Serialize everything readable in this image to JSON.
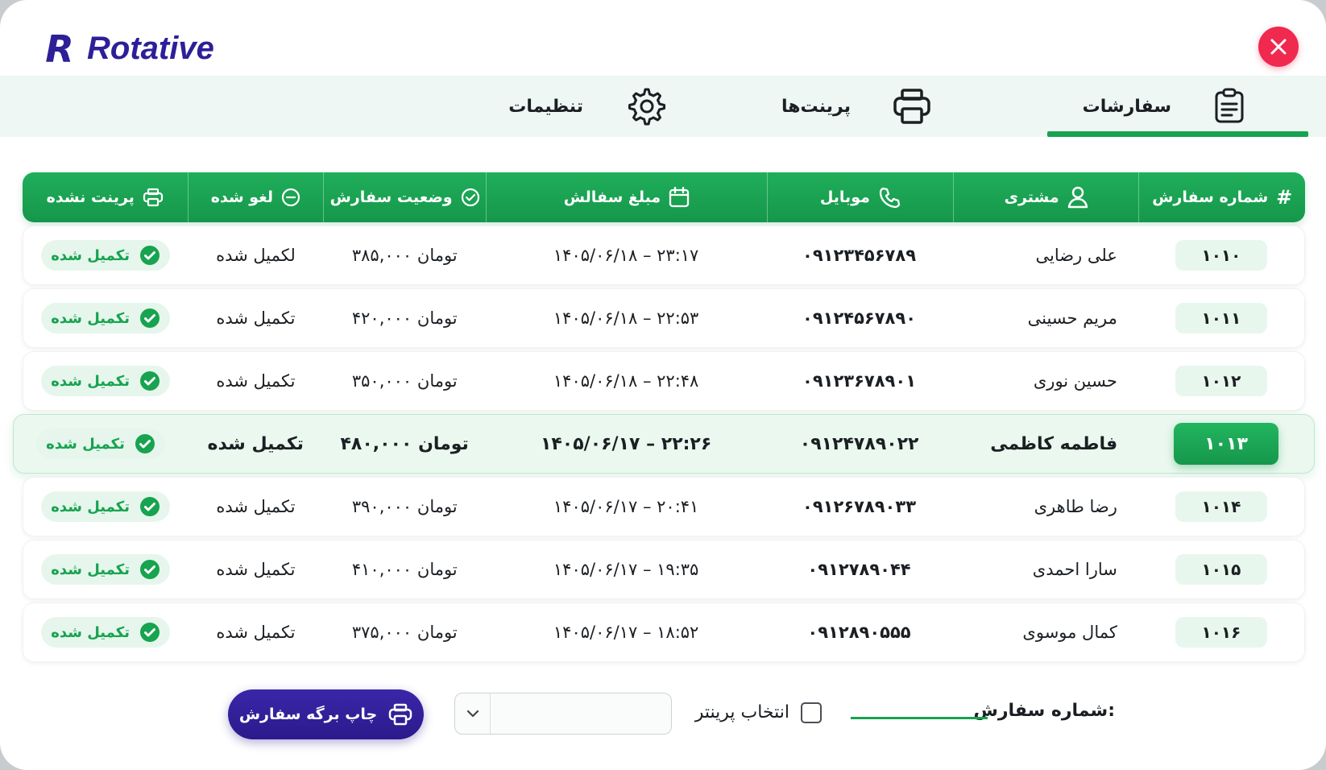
{
  "brand": {
    "mark": "R",
    "name": "Rotative"
  },
  "colors": {
    "accent": "#17a34f",
    "brand": "#2d1f98",
    "close": "#f0294f"
  },
  "tabs": [
    {
      "label": "سفارشات",
      "icon": "clipboard-icon",
      "active": true
    },
    {
      "label": "پرینت‌ها",
      "icon": "printer-icon",
      "active": false
    },
    {
      "label": "تنظیمات",
      "icon": "gear-icon",
      "active": false
    }
  ],
  "table": {
    "headers": {
      "id": "شماره سفارش",
      "customer": "مشتری",
      "mobile": "موبایل",
      "amount": "مبلغ سفالش",
      "status": "وضعیت سفارش",
      "cancelled": "لغو شده",
      "print": "پرینت نشده"
    },
    "rows": [
      {
        "id": "۱۰۱۰",
        "customer": "علی رضایی",
        "mobile": "۰۹۱۲۳۴۵۶۷۸۹",
        "date": "۱۴۰۵/۰۶/۱۸ – ۲۳:۱۷",
        "amount": "۳۸۵,۰۰۰ تومان",
        "status": "لکمیل شده",
        "badge": "تکمیل شده"
      },
      {
        "id": "۱۰۱۱",
        "customer": "مریم حسینی",
        "mobile": "۰۹۱۲۴۵۶۷۸۹۰",
        "date": "۱۴۰۵/۰۶/۱۸ – ۲۲:۵۳",
        "amount": "۴۲۰,۰۰۰ تومان",
        "status": "تکمیل شده",
        "badge": "تکمیل شده"
      },
      {
        "id": "۱۰۱۲",
        "customer": "حسین نوری",
        "mobile": "۰۹۱۲۳۶۷۸۹۰۱",
        "date": "۱۴۰۵/۰۶/۱۸ – ۲۲:۴۸",
        "amount": "۳۵۰,۰۰۰ تومان",
        "status": "تکمیل شده",
        "badge": "تکمیل شده"
      },
      {
        "id": "۱۰۱۳",
        "customer": "فاطمه کاظمی",
        "mobile": "۰۹۱۲۴۷۸۹۰۲۲",
        "date": "۱۴۰۵/۰۶/۱۷ – ۲۲:۲۶",
        "amount": "۴۸۰,۰۰۰ تومان",
        "status": "تکمیل شده",
        "badge": "تکمیل شده",
        "selected": true
      },
      {
        "id": "۱۰۱۴",
        "customer": "رضا طاهری",
        "mobile": "۰۹۱۲۶۷۸۹۰۳۳",
        "date": "۱۴۰۵/۰۶/۱۷ – ۲۰:۴۱",
        "amount": "۳۹۰,۰۰۰ تومان",
        "status": "تکمیل شده",
        "badge": "تکمیل شده"
      },
      {
        "id": "۱۰۱۵",
        "customer": "سارا احمدی",
        "mobile": "۰۹۱۲۷۸۹۰۴۴",
        "date": "۱۴۰۵/۰۶/۱۷ – ۱۹:۳۵",
        "amount": "۴۱۰,۰۰۰ تومان",
        "status": "تکمیل شده",
        "badge": "تکمیل شده"
      },
      {
        "id": "۱۰۱۶",
        "customer": "کمال موسوی",
        "mobile": "۰۹۱۲۸۹۰۵۵۵",
        "date": "۱۴۰۵/۰۶/۱۷ – ۱۸:۵۲",
        "amount": "۳۷۵,۰۰۰ تومان",
        "status": "تکمیل شده",
        "badge": "تکمیل شده"
      }
    ]
  },
  "footer": {
    "order_number_label": "شماره سفارش:",
    "select_printer_label": "انتخاب پرینتر",
    "printer_select_value": "",
    "print_button_label": "چاپ برگه سفارش"
  }
}
